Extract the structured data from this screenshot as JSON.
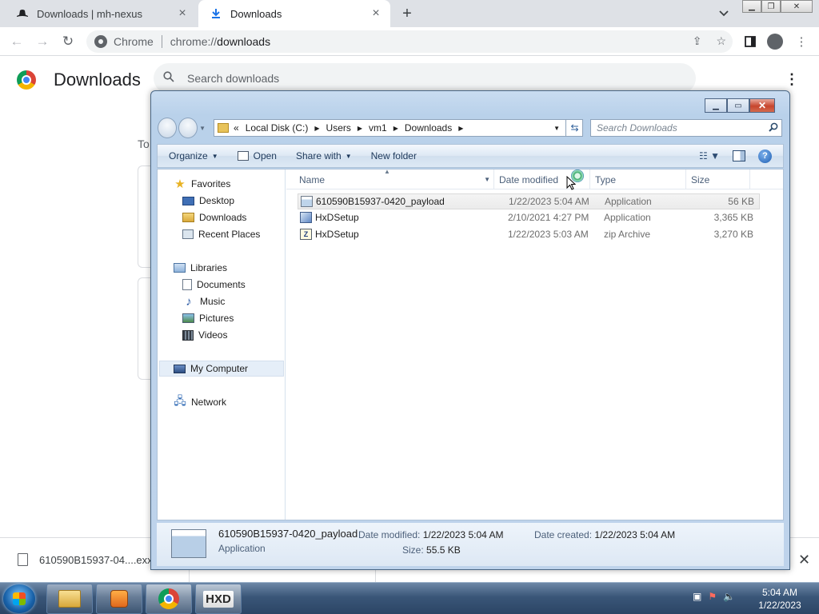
{
  "browser": {
    "tabs": [
      {
        "label": "Downloads | mh-nexus",
        "icon": "hat-icon"
      },
      {
        "label": "Downloads",
        "icon": "download-icon"
      }
    ],
    "omnibox": {
      "site": "Chrome",
      "url_scheme": "chrome://",
      "url_path": "downloads"
    }
  },
  "downloads_page": {
    "title": "Downloads",
    "search_placeholder": "Search downloads",
    "section_label_partial": "To"
  },
  "explorer": {
    "breadcrumb": [
      "«",
      "Local Disk (C:)",
      "Users",
      "vm1",
      "Downloads"
    ],
    "search_placeholder": "Search Downloads",
    "commands": {
      "organize": "Organize",
      "open": "Open",
      "share_with": "Share with",
      "new_folder": "New folder"
    },
    "nav_pane": {
      "favorites": {
        "header": "Favorites",
        "items": [
          "Desktop",
          "Downloads",
          "Recent Places"
        ]
      },
      "libraries": {
        "header": "Libraries",
        "items": [
          "Documents",
          "Music",
          "Pictures",
          "Videos"
        ]
      },
      "computer": "My Computer",
      "network": "Network"
    },
    "columns": {
      "name": "Name",
      "date": "Date modified",
      "type": "Type",
      "size": "Size"
    },
    "files": [
      {
        "name": "610590B15937-0420_payload",
        "date": "1/22/2023 5:04 AM",
        "type": "Application",
        "size": "56 KB",
        "icon": "application-icon"
      },
      {
        "name": "HxDSetup",
        "date": "2/10/2021 4:27 PM",
        "type": "Application",
        "size": "3,365 KB",
        "icon": "setup-icon"
      },
      {
        "name": "HxDSetup",
        "date": "1/22/2023 5:03 AM",
        "type": "zip Archive",
        "size": "3,270 KB",
        "icon": "zip-icon"
      }
    ],
    "details": {
      "name": "610590B15937-0420_payload",
      "type": "Application",
      "modified_label": "Date modified:",
      "modified_value": "1/22/2023 5:04 AM",
      "created_label": "Date created:",
      "created_value": "1/22/2023 5:04 AM",
      "size_label": "Size:",
      "size_value": "55.5 KB"
    }
  },
  "shelf": {
    "filename": "610590B15937-04....exx"
  },
  "taskbar": {
    "time": "5:04 AM",
    "date": "1/22/2023"
  }
}
